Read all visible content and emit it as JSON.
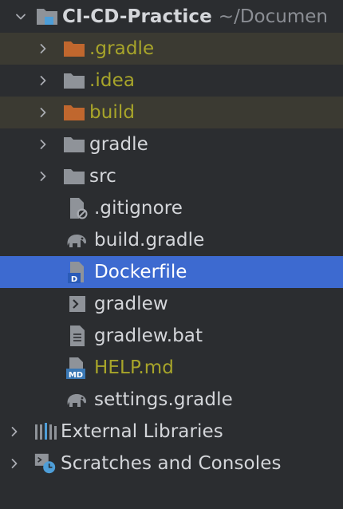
{
  "project": {
    "name": "CI-CD-Practice",
    "path": "~/Documen"
  },
  "items": [
    {
      "label": ".gradle"
    },
    {
      "label": ".idea"
    },
    {
      "label": "build"
    },
    {
      "label": "gradle"
    },
    {
      "label": "src"
    },
    {
      "label": ".gitignore"
    },
    {
      "label": "build.gradle"
    },
    {
      "label": "Dockerfile"
    },
    {
      "label": "gradlew"
    },
    {
      "label": "gradlew.bat"
    },
    {
      "label": "HELP.md"
    },
    {
      "label": "settings.gradle"
    }
  ],
  "roots": [
    {
      "label": "External Libraries"
    },
    {
      "label": "Scratches and Consoles"
    }
  ],
  "icons": {
    "dockerfile_badge": "D",
    "markdown_badge": "MD"
  },
  "colors": {
    "background": "#2b2d30",
    "selection": "#3d6ad0",
    "excluded_row": "#3b3a32",
    "excluded_folder": "#c0672e",
    "folder": "#8f9399",
    "ignored_text": "#a8a52a",
    "text": "#d4d6da",
    "accent_blue": "#4e9ed8"
  }
}
